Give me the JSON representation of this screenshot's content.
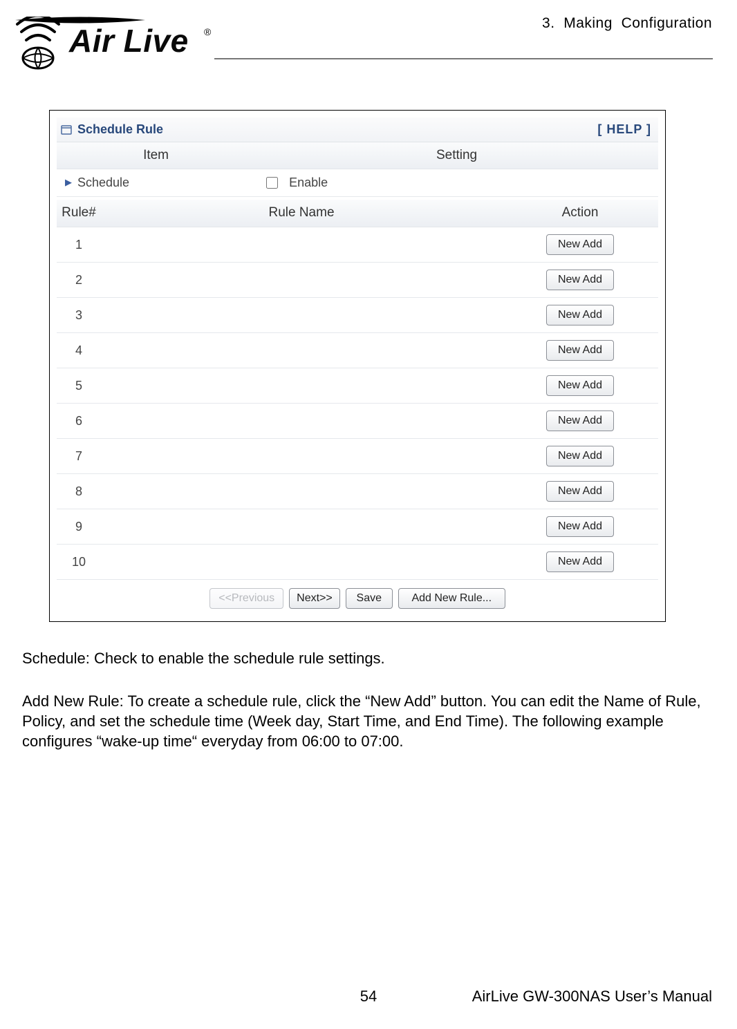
{
  "header": {
    "chapter": "3.  Making  Configuration",
    "logo_text": "Air Live",
    "registered": "®"
  },
  "panel": {
    "title": "Schedule Rule",
    "help": "[ HELP ]",
    "headers": {
      "item": "Item",
      "setting": "Setting"
    },
    "schedule_label": "Schedule",
    "enable_label": "Enable",
    "enable_checked": false,
    "rule_headers": {
      "num": "Rule#",
      "name": "Rule Name",
      "action": "Action"
    },
    "rows": [
      {
        "num": "1",
        "name": "",
        "action": "New Add"
      },
      {
        "num": "2",
        "name": "",
        "action": "New Add"
      },
      {
        "num": "3",
        "name": "",
        "action": "New Add"
      },
      {
        "num": "4",
        "name": "",
        "action": "New Add"
      },
      {
        "num": "5",
        "name": "",
        "action": "New Add"
      },
      {
        "num": "6",
        "name": "",
        "action": "New Add"
      },
      {
        "num": "7",
        "name": "",
        "action": "New Add"
      },
      {
        "num": "8",
        "name": "",
        "action": "New Add"
      },
      {
        "num": "9",
        "name": "",
        "action": "New Add"
      },
      {
        "num": "10",
        "name": "",
        "action": "New Add"
      }
    ],
    "footer_buttons": {
      "prev": "<<Previous",
      "next": "Next>>",
      "save": "Save",
      "add_new": "Add New Rule..."
    }
  },
  "paragraphs": {
    "p1": "Schedule: Check to enable the schedule rule settings.",
    "p2": "Add New Rule: To create a schedule rule, click the “New Add” button. You can edit the Name of Rule, Policy, and set the schedule time (Week day, Start Time, and End Time). The following example configures “wake-up time“ everyday from 06:00 to 07:00."
  },
  "footer": {
    "page": "54",
    "manual": "AirLive GW-300NAS User’s Manual"
  }
}
